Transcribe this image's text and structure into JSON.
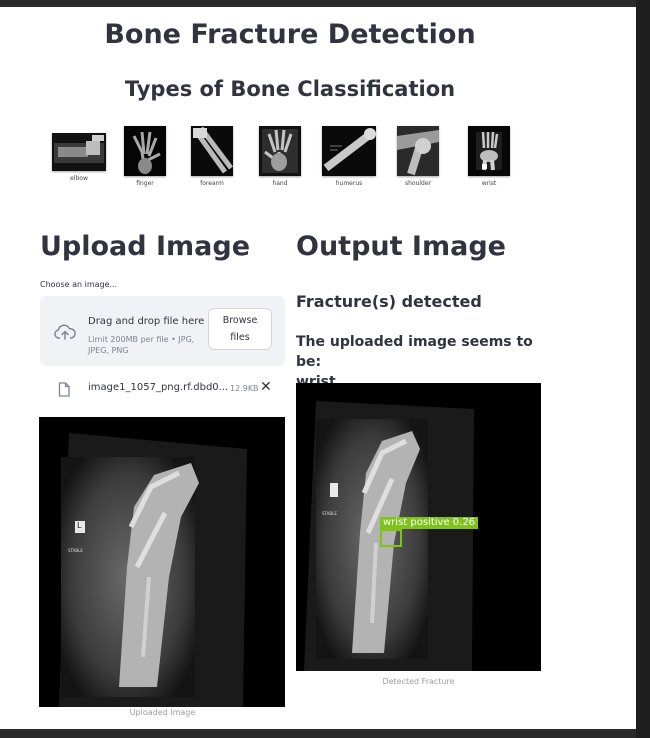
{
  "header": {
    "title": "Bone Fracture Detection",
    "types_title": "Types of Bone Classification"
  },
  "bone_types": [
    {
      "label": "elbow"
    },
    {
      "label": "finger"
    },
    {
      "label": "forearm"
    },
    {
      "label": "hand"
    },
    {
      "label": "humerus"
    },
    {
      "label": "shoulder"
    },
    {
      "label": "wrist"
    }
  ],
  "upload": {
    "heading": "Upload Image",
    "input_label": "Choose an image...",
    "dropzone_title": "Drag and drop file here",
    "dropzone_limit": "Limit 200MB per file • JPG, JPEG, PNG",
    "browse_line1": "Browse",
    "browse_line2": "files",
    "file_name": "image1_1057_png.rf.dbd0...",
    "file_size": "12.9KB",
    "close_glyph": "✕",
    "image_caption": "Uploaded Image",
    "xray_marker": "L",
    "xray_tag": "STABLE"
  },
  "output": {
    "heading": "Output Image",
    "status": "Fracture(s) detected",
    "result_prefix": "The uploaded image seems to be:",
    "result_value": "wrist",
    "detection_label": "wrist positive  0.26",
    "image_caption": "Detected Fracture"
  },
  "colors": {
    "text": "#31333f",
    "dropzone_bg": "#f0f2f6",
    "detection": "#7ec21a",
    "caption": "#9a9ca5"
  },
  "icons": {
    "upload": "cloud-upload-icon",
    "file": "file-icon",
    "close": "close-icon"
  }
}
